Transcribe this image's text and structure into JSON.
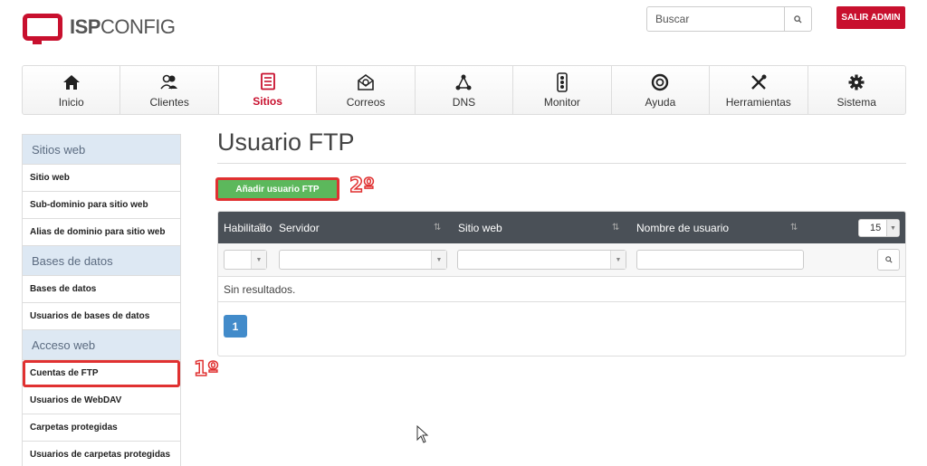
{
  "header": {
    "logo_bold": "ISP",
    "logo_light": "CONFIG",
    "search_placeholder": "Buscar",
    "logout_label": "SALIR ADMIN"
  },
  "nav": {
    "items": [
      {
        "label": "Inicio",
        "icon": "home-icon",
        "glyph": "⌂"
      },
      {
        "label": "Clientes",
        "icon": "users-icon",
        "glyph": "👥"
      },
      {
        "label": "Sitios",
        "icon": "sites-icon",
        "glyph": "▤"
      },
      {
        "label": "Correos",
        "icon": "mail-icon",
        "glyph": "✉"
      },
      {
        "label": "DNS",
        "icon": "network-icon",
        "glyph": "⟁"
      },
      {
        "label": "Monitor",
        "icon": "traffic-light-icon",
        "glyph": "⋮"
      },
      {
        "label": "Ayuda",
        "icon": "lifebuoy-icon",
        "glyph": "◎"
      },
      {
        "label": "Herramientas",
        "icon": "tools-icon",
        "glyph": "✕"
      },
      {
        "label": "Sistema",
        "icon": "gear-icon",
        "glyph": "✱"
      }
    ],
    "active": "Sitios"
  },
  "sidebar": {
    "sections": [
      {
        "header": "Sitios web",
        "items": [
          "Sitio web",
          "Sub-dominio para sitio web",
          "Alias de dominio para sitio web"
        ]
      },
      {
        "header": "Bases de datos",
        "items": [
          "Bases de datos",
          "Usuarios de bases de datos"
        ]
      },
      {
        "header": "Acceso web",
        "items": [
          "Cuentas de FTP",
          "Usuarios de WebDAV",
          "Carpetas protegidas",
          "Usuarios de carpetas protegidas"
        ]
      }
    ],
    "highlighted": "Cuentas de FTP"
  },
  "main": {
    "title": "Usuario FTP",
    "add_button": "Añadir usuario FTP",
    "columns": [
      "Habilitado",
      "Servidor",
      "Sitio web",
      "Nombre de usuario"
    ],
    "page_size": "15",
    "no_results": "Sin resultados.",
    "current_page": "1"
  },
  "annotations": {
    "step1": "1º",
    "step2": "2º"
  },
  "colors": {
    "brand_red": "#c8102e",
    "annotation_red": "#e03131",
    "add_green": "#5cb85c",
    "pager_blue": "#428bca",
    "table_header": "#4a5057"
  }
}
